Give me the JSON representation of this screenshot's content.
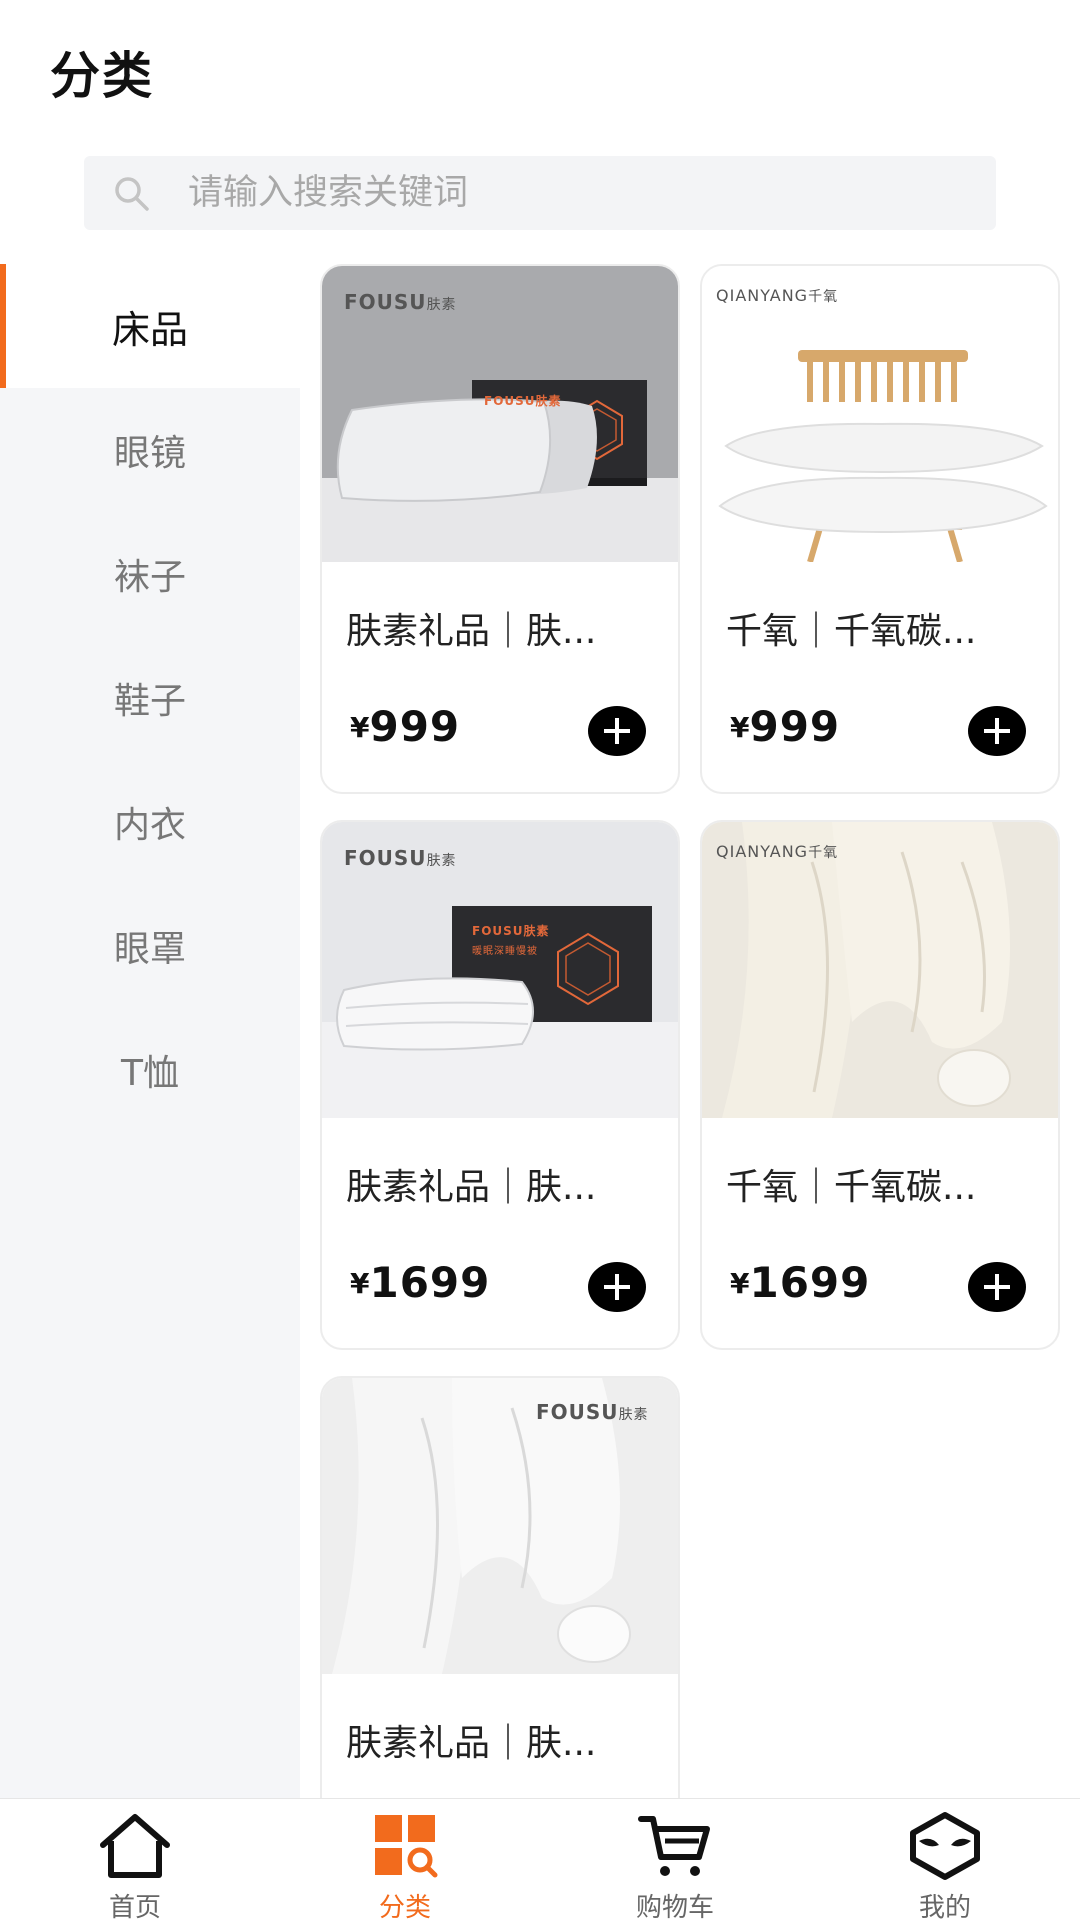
{
  "header": {
    "title": "分类"
  },
  "search": {
    "placeholder": "请输入搜索关键词"
  },
  "sidebar": {
    "items": [
      {
        "label": "床品",
        "active": true
      },
      {
        "label": "眼镜",
        "active": false
      },
      {
        "label": "袜子",
        "active": false
      },
      {
        "label": "鞋子",
        "active": false
      },
      {
        "label": "内衣",
        "active": false
      },
      {
        "label": "眼罩",
        "active": false
      },
      {
        "label": "T恤",
        "active": false
      }
    ]
  },
  "products": [
    {
      "name": "肤素礼品｜肤...",
      "currency": "¥",
      "price": "999",
      "brand": "FOUSU",
      "brand_cn": "肤素",
      "box_text": "FOUSU肤素",
      "image": "pillow-gift-box"
    },
    {
      "name": "千氧｜千氧碳...",
      "currency": "¥",
      "price": "999",
      "brand": "QIANYANG",
      "brand_cn": "千氧",
      "image": "pillows-on-chair"
    },
    {
      "name": "肤素礼品｜肤...",
      "currency": "¥",
      "price": "1699",
      "brand": "FOUSU",
      "brand_cn": "肤素",
      "box_text": "FOUSU肤素",
      "box_sub": "暖眠深睡慢被",
      "image": "quilt-gift-box"
    },
    {
      "name": "千氧｜千氧碳...",
      "currency": "¥",
      "price": "1699",
      "brand": "QIANYANG",
      "brand_cn": "千氧",
      "image": "quilt-draped"
    },
    {
      "name": "肤素礼品｜肤...",
      "brand": "FOUSU",
      "brand_cn": "肤素",
      "image": "quilt-draped-white"
    }
  ],
  "tabbar": {
    "items": [
      {
        "label": "首页",
        "icon": "home-icon",
        "active": false
      },
      {
        "label": "分类",
        "icon": "category-icon",
        "active": true
      },
      {
        "label": "购物车",
        "icon": "cart-icon",
        "active": false
      },
      {
        "label": "我的",
        "icon": "profile-icon",
        "active": false
      }
    ]
  },
  "colors": {
    "accent": "#f26b1d",
    "sidebar_bg": "#f5f6f8",
    "search_bg": "#f3f4f6"
  }
}
